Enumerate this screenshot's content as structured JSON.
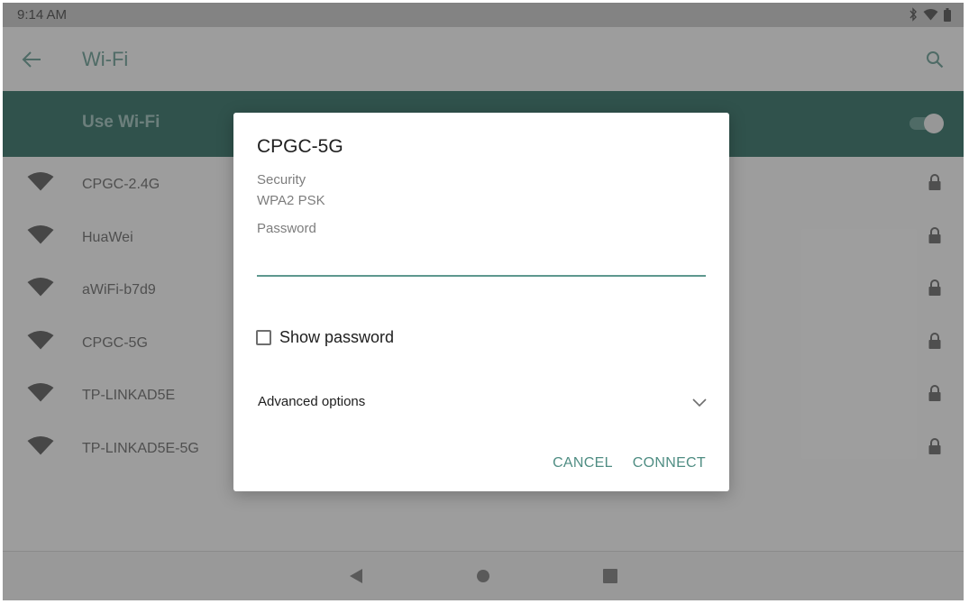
{
  "status_bar": {
    "time": "9:14 AM",
    "icons": [
      "bluetooth-icon",
      "wifi-signal-icon",
      "battery-icon"
    ]
  },
  "app_bar": {
    "title": "Wi-Fi",
    "back_icon": "arrow-left-icon",
    "search_icon": "search-icon"
  },
  "use_wifi": {
    "label": "Use Wi-Fi",
    "enabled": true
  },
  "networks": [
    {
      "ssid": "CPGC-2.4G",
      "secured": true
    },
    {
      "ssid": "HuaWei",
      "secured": true
    },
    {
      "ssid": "aWiFi-b7d9",
      "secured": true
    },
    {
      "ssid": "CPGC-5G",
      "secured": true
    },
    {
      "ssid": "TP-LINKAD5E",
      "secured": true
    },
    {
      "ssid": "TP-LINKAD5E-5G",
      "secured": true
    }
  ],
  "dialog": {
    "title": "CPGC-5G",
    "security_label": "Security",
    "security_value": "WPA2 PSK",
    "password_label": "Password",
    "password_value": "",
    "show_password_label": "Show password",
    "show_password_checked": false,
    "advanced_options_label": "Advanced options",
    "cancel_label": "CANCEL",
    "connect_label": "CONNECT"
  },
  "nav_bar": {
    "buttons": [
      "back-triangle-icon",
      "home-circle-icon",
      "recents-square-icon"
    ]
  },
  "colors": {
    "accent": "#4f8d83",
    "header_band": "#4b7f76"
  }
}
